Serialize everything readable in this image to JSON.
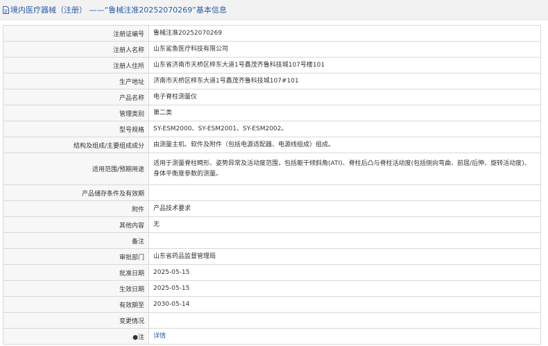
{
  "header": {
    "icon": "document-icon",
    "title": "境内医疗器械（注册）  ——“鲁械注准20252070269”基本信息"
  },
  "rows": [
    {
      "label": "注册证编号",
      "value": "鲁械注准20252070269"
    },
    {
      "label": "注册人名称",
      "value": "山东鲨鱼医疗科技有限公司"
    },
    {
      "label": "注册人住所",
      "value": "山东省济南市天桥区梓东大道1号鑫茂齐鲁科技城107号楼101"
    },
    {
      "label": "生产地址",
      "value": "济南市天桥区梓东大道1号鑫茂齐鲁科技城107#101"
    },
    {
      "label": "产品名称",
      "value": "电子脊柱测量仪"
    },
    {
      "label": "管理类别",
      "value": "第二类"
    },
    {
      "label": "型号规格",
      "value": "SY-ESM2000、SY-ESM2001、SY-ESM2002。"
    },
    {
      "label": "结构及组成/主要组成成分",
      "value": "由测量主机、软件及附件（包括电源适配器、电源线组成）组成。"
    },
    {
      "label": "适用范围/预期用途",
      "value": "适用于测量脊柱畸形、姿势异常及活动度范围，包括躯干倾斜角(ATI)、脊柱后凸与脊柱活动度(包括侧向弯曲、前屈/后伸、旋转活动度)、身体平衡度参数的测量。"
    },
    {
      "label": "产品储存条件及有效期",
      "value": ""
    },
    {
      "label": "附件",
      "value": "产品技术要求"
    },
    {
      "label": "其他内容",
      "value": "无"
    },
    {
      "label": "备注",
      "value": ""
    },
    {
      "label": "审批部门",
      "value": "山东省药品监督管理局"
    },
    {
      "label": "批准日期",
      "value": "2025-05-15"
    },
    {
      "label": "生效日期",
      "value": "2025-05-15"
    },
    {
      "label": "有效期至",
      "value": "2030-05-14"
    },
    {
      "label": "变更情况",
      "value": ""
    },
    {
      "label": "●注",
      "value": "详情"
    }
  ]
}
